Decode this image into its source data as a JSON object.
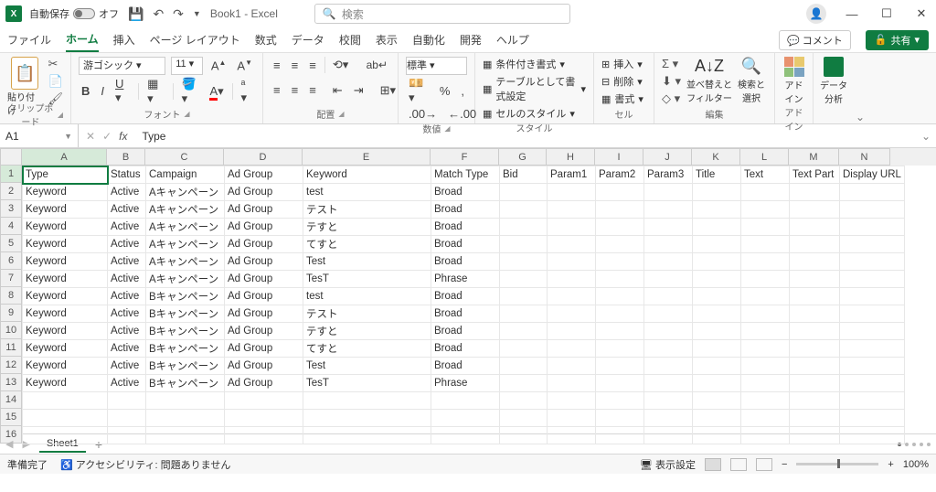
{
  "titlebar": {
    "autosave_label": "自動保存",
    "autosave_state": "オフ",
    "doc": "Book1 - Excel",
    "search_placeholder": "検索"
  },
  "tabs": {
    "items": [
      "ファイル",
      "ホーム",
      "挿入",
      "ページ レイアウト",
      "数式",
      "データ",
      "校閲",
      "表示",
      "自動化",
      "開発",
      "ヘルプ"
    ],
    "active_index": 1,
    "comment": "コメント",
    "share": "共有"
  },
  "ribbon": {
    "clipboard": {
      "paste": "貼り付け",
      "label": "クリップボード"
    },
    "font": {
      "name": "游ゴシック",
      "size": "11",
      "label": "フォント"
    },
    "align": {
      "label": "配置"
    },
    "number": {
      "format": "標準",
      "label": "数値"
    },
    "styles": {
      "cond": "条件付き書式",
      "table": "テーブルとして書式設定",
      "cell": "セルのスタイル",
      "label": "スタイル"
    },
    "cells": {
      "insert": "挿入",
      "delete": "削除",
      "format": "書式",
      "label": "セル"
    },
    "editing": {
      "sort": "並べ替えと\nフィルター",
      "find": "検索と\n選択",
      "label": "編集"
    },
    "addin": {
      "label": "アドイン",
      "btn": "アド\nイン"
    },
    "analysis": {
      "label": "データ\n分析"
    }
  },
  "fx": {
    "namebox": "A1",
    "formula": "Type"
  },
  "columns": [
    "A",
    "B",
    "C",
    "D",
    "E",
    "F",
    "G",
    "H",
    "I",
    "J",
    "K",
    "L",
    "M",
    "N"
  ],
  "col_widths": [
    "col-A",
    "col-B",
    "col-C",
    "col-D",
    "col-E",
    "col-F",
    "col-G",
    "col-H",
    "col-I",
    "col-J",
    "col-K",
    "col-L",
    "col-M",
    "col-N"
  ],
  "row_count": 16,
  "active_cell": {
    "row": 0,
    "col": 0
  },
  "data_rows": [
    [
      "Type",
      "Status",
      "Campaign",
      "Ad Group",
      "Keyword",
      "Match Type",
      "Bid",
      "Param1",
      "Param2",
      "Param3",
      "Title",
      "Text",
      "Text Part",
      "Display URL"
    ],
    [
      "Keyword",
      "Active",
      "Aキャンペーン",
      "Ad Group",
      "test",
      "Broad",
      "",
      "",
      "",
      "",
      "",
      "",
      "",
      ""
    ],
    [
      "Keyword",
      "Active",
      "Aキャンペーン",
      "Ad Group",
      "テスト",
      "Broad",
      "",
      "",
      "",
      "",
      "",
      "",
      "",
      ""
    ],
    [
      "Keyword",
      "Active",
      "Aキャンペーン",
      "Ad Group",
      "テすと",
      "Broad",
      "",
      "",
      "",
      "",
      "",
      "",
      "",
      ""
    ],
    [
      "Keyword",
      "Active",
      "Aキャンペーン",
      "Ad Group",
      "てすと",
      "Broad",
      "",
      "",
      "",
      "",
      "",
      "",
      "",
      ""
    ],
    [
      "Keyword",
      "Active",
      "Aキャンペーン",
      "Ad Group",
      "Test",
      "Broad",
      "",
      "",
      "",
      "",
      "",
      "",
      "",
      ""
    ],
    [
      "Keyword",
      "Active",
      "Aキャンペーン",
      "Ad Group",
      "TesT",
      "Phrase",
      "",
      "",
      "",
      "",
      "",
      "",
      "",
      ""
    ],
    [
      "Keyword",
      "Active",
      "Bキャンペーン",
      "Ad Group",
      "test",
      "Broad",
      "",
      "",
      "",
      "",
      "",
      "",
      "",
      ""
    ],
    [
      "Keyword",
      "Active",
      "Bキャンペーン",
      "Ad Group",
      "テスト",
      "Broad",
      "",
      "",
      "",
      "",
      "",
      "",
      "",
      ""
    ],
    [
      "Keyword",
      "Active",
      "Bキャンペーン",
      "Ad Group",
      "テすと",
      "Broad",
      "",
      "",
      "",
      "",
      "",
      "",
      "",
      ""
    ],
    [
      "Keyword",
      "Active",
      "Bキャンペーン",
      "Ad Group",
      "てすと",
      "Broad",
      "",
      "",
      "",
      "",
      "",
      "",
      "",
      ""
    ],
    [
      "Keyword",
      "Active",
      "Bキャンペーン",
      "Ad Group",
      "Test",
      "Broad",
      "",
      "",
      "",
      "",
      "",
      "",
      "",
      ""
    ],
    [
      "Keyword",
      "Active",
      "Bキャンペーン",
      "Ad Group",
      "TesT",
      "Phrase",
      "",
      "",
      "",
      "",
      "",
      "",
      "",
      ""
    ]
  ],
  "sheet": {
    "name": "Sheet1"
  },
  "status": {
    "ready": "準備完了",
    "access": "アクセシビリティ: 問題ありません",
    "display": "表示設定",
    "zoom": "100%"
  }
}
